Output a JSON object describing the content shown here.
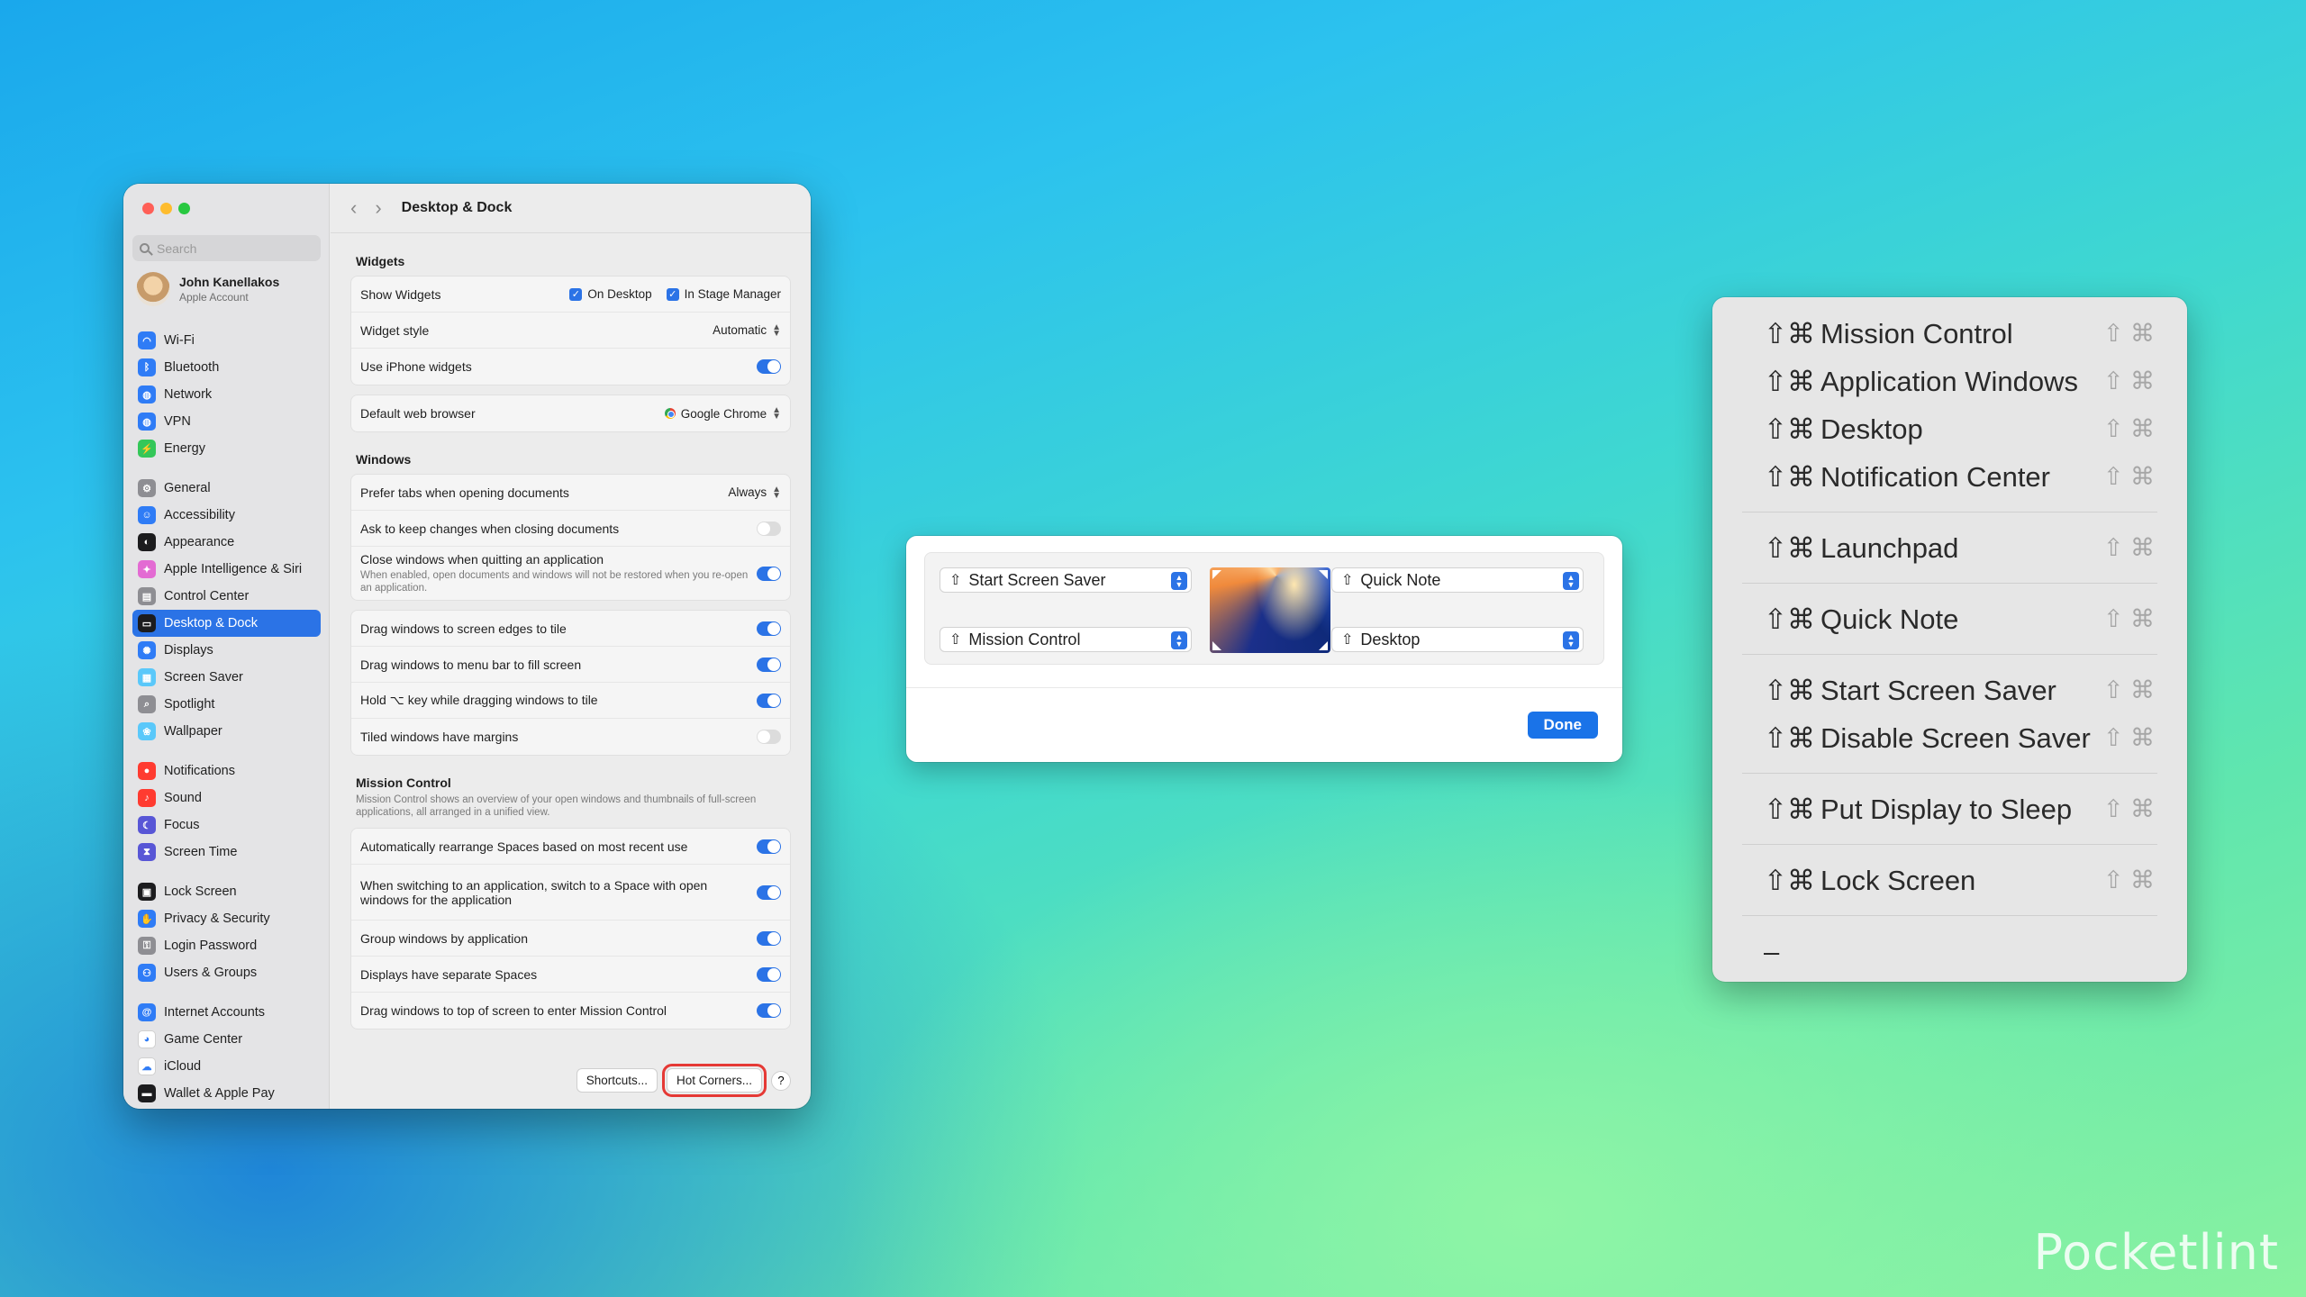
{
  "settings": {
    "title": "Desktop & Dock",
    "search_placeholder": "Search",
    "account": {
      "name": "John Kanellakos",
      "sub": "Apple Account"
    },
    "sidebar": {
      "groups": [
        [
          {
            "label": "Wi-Fi",
            "icon": "wifi-icon",
            "color": "#2f7cf6",
            "glyph": "◠"
          },
          {
            "label": "Bluetooth",
            "icon": "bluetooth-icon",
            "color": "#2f7cf6",
            "glyph": "ᛒ"
          },
          {
            "label": "Network",
            "icon": "network-icon",
            "color": "#2f7cf6",
            "glyph": "◍"
          },
          {
            "label": "VPN",
            "icon": "vpn-icon",
            "color": "#2f7cf6",
            "glyph": "◍"
          },
          {
            "label": "Energy",
            "icon": "energy-icon",
            "color": "#34c759",
            "glyph": "⚡"
          }
        ],
        [
          {
            "label": "General",
            "icon": "gear-icon",
            "color": "#8e8e93",
            "glyph": "⚙"
          },
          {
            "label": "Accessibility",
            "icon": "accessibility-icon",
            "color": "#2f7cf6",
            "glyph": "☺"
          },
          {
            "label": "Appearance",
            "icon": "appearance-icon",
            "color": "#1c1c1e",
            "glyph": "◐"
          },
          {
            "label": "Apple Intelligence & Siri",
            "icon": "siri-icon",
            "color": "#e36bd3",
            "glyph": "✦"
          },
          {
            "label": "Control Center",
            "icon": "control-center-icon",
            "color": "#8e8e93",
            "glyph": "▤"
          },
          {
            "label": "Desktop & Dock",
            "icon": "dock-icon",
            "color": "#1c1c1e",
            "glyph": "▭",
            "active": true
          },
          {
            "label": "Displays",
            "icon": "displays-icon",
            "color": "#2f7cf6",
            "glyph": "✺"
          },
          {
            "label": "Screen Saver",
            "icon": "screen-saver-icon",
            "color": "#5ac8fa",
            "glyph": "▦"
          },
          {
            "label": "Spotlight",
            "icon": "spotlight-icon",
            "color": "#8e8e93",
            "glyph": "⌕"
          },
          {
            "label": "Wallpaper",
            "icon": "wallpaper-icon",
            "color": "#5ac8fa",
            "glyph": "❀"
          }
        ],
        [
          {
            "label": "Notifications",
            "icon": "notifications-icon",
            "color": "#ff3b30",
            "glyph": "●"
          },
          {
            "label": "Sound",
            "icon": "sound-icon",
            "color": "#ff3b30",
            "glyph": "♪"
          },
          {
            "label": "Focus",
            "icon": "focus-icon",
            "color": "#5856d6",
            "glyph": "☾"
          },
          {
            "label": "Screen Time",
            "icon": "screen-time-icon",
            "color": "#5856d6",
            "glyph": "⧗"
          }
        ],
        [
          {
            "label": "Lock Screen",
            "icon": "lock-screen-icon",
            "color": "#1c1c1e",
            "glyph": "▣"
          },
          {
            "label": "Privacy & Security",
            "icon": "privacy-icon",
            "color": "#2f7cf6",
            "glyph": "✋"
          },
          {
            "label": "Login Password",
            "icon": "login-password-icon",
            "color": "#8e8e93",
            "glyph": "⚿"
          },
          {
            "label": "Users & Groups",
            "icon": "users-icon",
            "color": "#2f7cf6",
            "glyph": "⚇"
          }
        ],
        [
          {
            "label": "Internet Accounts",
            "icon": "internet-accounts-icon",
            "color": "#2f7cf6",
            "glyph": "@"
          },
          {
            "label": "Game Center",
            "icon": "game-center-icon",
            "color": "#ffffff",
            "glyph": "◕"
          },
          {
            "label": "iCloud",
            "icon": "icloud-icon",
            "color": "#ffffff",
            "glyph": "☁"
          },
          {
            "label": "Wallet & Apple Pay",
            "icon": "wallet-icon",
            "color": "#1c1c1e",
            "glyph": "▬"
          }
        ]
      ]
    },
    "widgets": {
      "heading": "Widgets",
      "show_widgets": "Show Widgets",
      "on_desktop": "On Desktop",
      "in_stage_manager": "In Stage Manager",
      "widget_style": "Widget style",
      "widget_style_value": "Automatic",
      "use_iphone_widgets": "Use iPhone widgets",
      "default_browser": "Default web browser",
      "default_browser_value": "Google Chrome"
    },
    "windows": {
      "heading": "Windows",
      "prefer_tabs": "Prefer tabs when opening documents",
      "prefer_tabs_value": "Always",
      "ask_keep_changes": "Ask to keep changes when closing documents",
      "close_windows": "Close windows when quitting an application",
      "close_windows_desc": "When enabled, open documents and windows will not be restored when you re-open an application.",
      "drag_edges": "Drag windows to screen edges to tile",
      "drag_menu_bar": "Drag windows to menu bar to fill screen",
      "hold_key": "Hold ⌥ key while dragging windows to tile",
      "tiled_margins": "Tiled windows have margins"
    },
    "mission_control": {
      "heading": "Mission Control",
      "desc": "Mission Control shows an overview of your open windows and thumbnails of full-screen applications, all arranged in a unified view.",
      "auto_rearrange": "Automatically rearrange Spaces based on most recent use",
      "switch_space": "When switching to an application, switch to a Space with open windows for the application",
      "group_windows": "Group windows by application",
      "separate_spaces": "Displays have separate Spaces",
      "drag_top": "Drag windows to top of screen to enter Mission Control"
    },
    "buttons": {
      "shortcuts": "Shortcuts...",
      "hot_corners": "Hot Corners...",
      "help": "?"
    }
  },
  "hot_corners": {
    "top_left": "Start Screen Saver",
    "top_right": "Quick Note",
    "bottom_left": "Mission Control",
    "bottom_right": "Desktop",
    "modifier_glyph": "⇧",
    "done": "Done"
  },
  "menu": {
    "prefix": "⇧⌘",
    "shortcut": "⇧ ⌘",
    "groups": [
      [
        "Mission Control",
        "Application Windows",
        "Desktop",
        "Notification Center"
      ],
      [
        "Launchpad"
      ],
      [
        "Quick Note"
      ],
      [
        "Start Screen Saver",
        "Disable Screen Saver"
      ],
      [
        "Put Display to Sleep"
      ],
      [
        "Lock Screen"
      ]
    ],
    "dash": "–"
  },
  "watermark": "Pocketlint"
}
